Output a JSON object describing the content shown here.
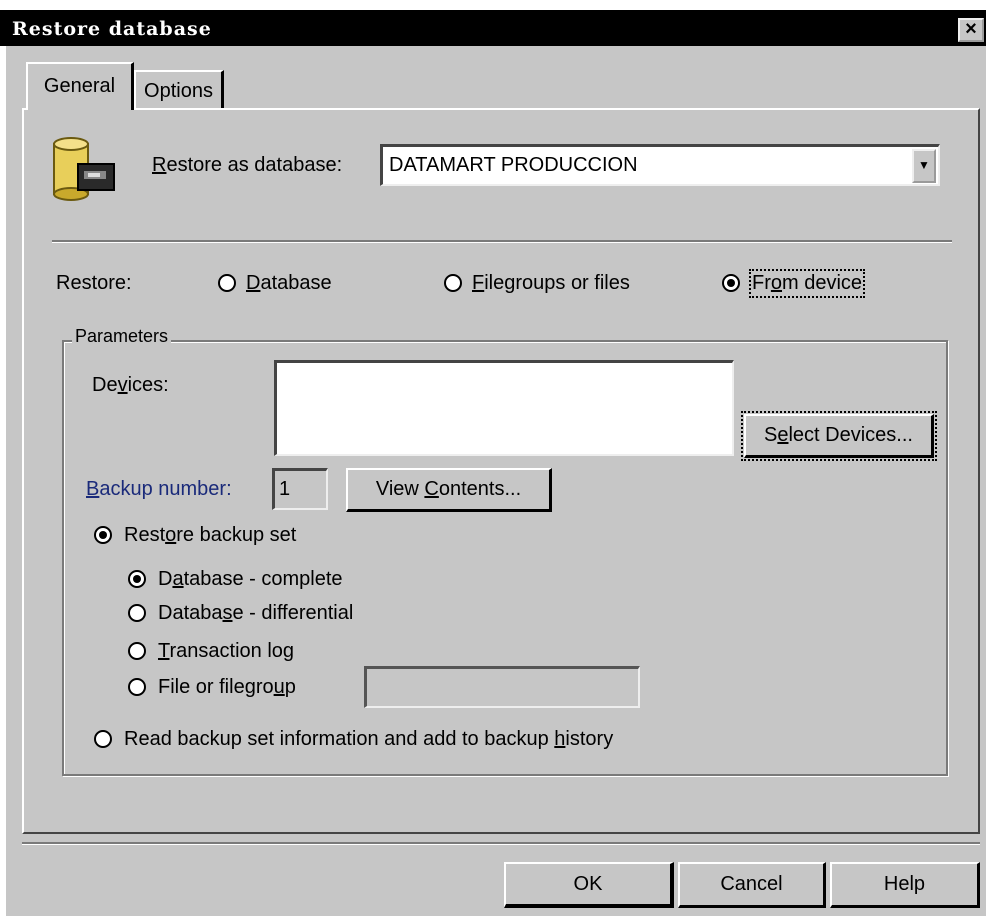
{
  "window": {
    "title": "Restore database",
    "close_glyph": "×"
  },
  "tabs": [
    {
      "label": "General",
      "active": true
    },
    {
      "label": "Options",
      "active": false
    }
  ],
  "restore_as": {
    "label_first": "R",
    "label_rest": "estore as database:",
    "value": "DATAMART PRODUCCION",
    "icon": "database-icon"
  },
  "restore": {
    "label": "Restore:",
    "options": [
      {
        "u": "D",
        "rest": "atabase",
        "selected": false
      },
      {
        "u": "F",
        "rest": "ilegroups or files",
        "selected": false
      },
      {
        "pre": "Fr",
        "u": "o",
        "rest": "m device",
        "selected": true
      }
    ]
  },
  "parameters": {
    "title": "Parameters",
    "devices_label_pre": "De",
    "devices_label_u": "v",
    "devices_label_rest": "ices:",
    "select_devices_pre": "S",
    "select_devices_u": "e",
    "select_devices_rest": "lect Devices...",
    "backup_number_u": "B",
    "backup_number_rest": "ackup number:",
    "backup_number_value": "1",
    "view_contents_pre": "View ",
    "view_contents_u": "C",
    "view_contents_rest": "ontents...",
    "restore_backup_set_pre": "Rest",
    "restore_backup_set_u": "o",
    "restore_backup_set_rest": "re backup set",
    "set_types": [
      {
        "pre": "D",
        "u": "a",
        "rest": "tabase - complete",
        "selected": true
      },
      {
        "pre": "Databa",
        "u": "s",
        "rest": "e - differential",
        "selected": false
      },
      {
        "pre": "",
        "u": "T",
        "rest": "ransaction log",
        "selected": false
      },
      {
        "pre": "File or filegro",
        "u": "u",
        "rest": "p",
        "selected": false
      }
    ],
    "read_info_pre": "Read backup set information and add to backup ",
    "read_info_u": "h",
    "read_info_rest": "istory"
  },
  "buttons": {
    "ok": "OK",
    "cancel": "Cancel",
    "help": "Help"
  },
  "colors": {
    "face": "#c6c6c6",
    "titlebar": "#000000",
    "icon_yellow": "#e8cf5a"
  }
}
